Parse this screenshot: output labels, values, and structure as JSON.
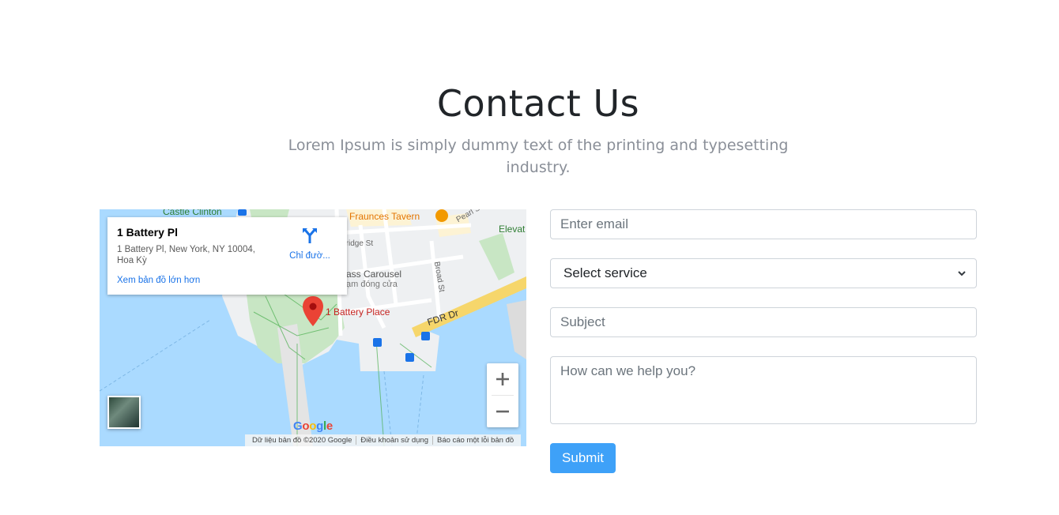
{
  "header": {
    "title": "Contact Us",
    "subtitle": "Lorem Ipsum is simply dummy text of the printing and typesetting industry."
  },
  "map": {
    "info_card": {
      "title": "1 Battery Pl",
      "address": "1 Battery Pl, New York, NY 10004, Hoa Kỳ",
      "directions_label": "Chỉ đườ...",
      "larger_map_link": "Xem bản đồ lớn hơn"
    },
    "labels": {
      "castle_clinton": "Castle Clinton",
      "fraunces_tavern": "Fraunces Tavern",
      "pearl_st": "Pearl St",
      "bridge_st": "Bridge St",
      "carousel": "ass Carousel",
      "temp_closed": "ạm đóng cửa",
      "broad_st": "Broad St",
      "fdr_dr": "FDR Dr",
      "elevat": "Elevat",
      "battery_place": "1 Battery Place"
    },
    "google_logo": "Google",
    "attribution": [
      "Dữ liệu bản đồ ©2020 Google",
      "Điều khoản sử dụng",
      "Báo cáo một lỗi bản đồ"
    ],
    "zoom_in": "+",
    "zoom_out": "−"
  },
  "form": {
    "email_placeholder": "Enter email",
    "service_selected": "Select service",
    "subject_placeholder": "Subject",
    "message_placeholder": "How can we help you?",
    "submit_label": "Submit"
  },
  "colors": {
    "accent": "#3ea1f8",
    "water": "#aadaff",
    "park": "#c6e8c3",
    "marker": "#ea4335"
  }
}
